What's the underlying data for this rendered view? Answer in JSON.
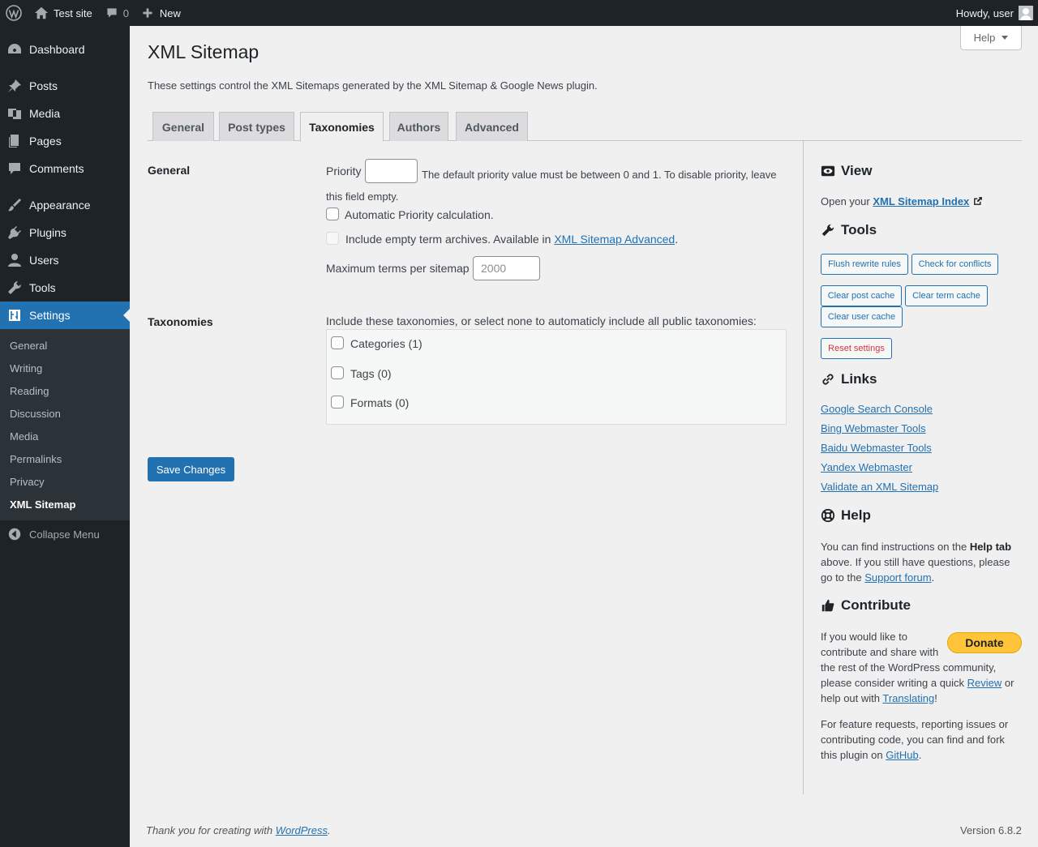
{
  "adminbar": {
    "site_name": "Test site",
    "comments_count": "0",
    "new_label": "New",
    "howdy": "Howdy, user"
  },
  "sidebar": {
    "items": [
      {
        "label": "Dashboard",
        "icon": "dashboard-icon"
      },
      {
        "label": "Posts",
        "icon": "pin-icon"
      },
      {
        "label": "Media",
        "icon": "media-icon"
      },
      {
        "label": "Pages",
        "icon": "pages-icon"
      },
      {
        "label": "Comments",
        "icon": "comment-icon"
      },
      {
        "label": "Appearance",
        "icon": "brush-icon"
      },
      {
        "label": "Plugins",
        "icon": "plug-icon"
      },
      {
        "label": "Users",
        "icon": "user-icon"
      },
      {
        "label": "Tools",
        "icon": "wrench-icon"
      },
      {
        "label": "Settings",
        "icon": "settings-icon"
      }
    ],
    "submenu": [
      "General",
      "Writing",
      "Reading",
      "Discussion",
      "Media",
      "Permalinks",
      "Privacy",
      "XML Sitemap"
    ],
    "collapse": "Collapse Menu"
  },
  "help_button": "Help",
  "page": {
    "title": "XML Sitemap",
    "intro": "These settings control the XML Sitemaps generated by the XML Sitemap & Google News plugin.",
    "tabs": [
      "General",
      "Post types",
      "Taxonomies",
      "Authors",
      "Advanced"
    ],
    "active_tab": "Taxonomies"
  },
  "general_section": {
    "label": "General",
    "priority_label": "Priority",
    "priority_value": "",
    "priority_desc_1": "The default priority value must be between 0 and 1. To disable priority, leave",
    "priority_desc_2": "this field empty.",
    "auto_priority": "Automatic Priority calculation.",
    "empty_terms_text": "Include empty term archives. Available in ",
    "empty_terms_link": "XML Sitemap Advanced",
    "empty_terms_end": ".",
    "max_terms_label": "Maximum terms per sitemap",
    "max_terms_placeholder": "2000"
  },
  "taxonomies_section": {
    "label": "Taxonomies",
    "intro": "Include these taxonomies, or select none to automaticly include all public taxonomies:",
    "items": [
      "Categories (1)",
      "Tags (0)",
      "Formats (0)"
    ]
  },
  "save_button": "Save Changes",
  "right_panel": {
    "view_heading": "View",
    "view_text": "Open your ",
    "view_link": "XML Sitemap Index",
    "tools_heading": "Tools",
    "tool_buttons": [
      "Flush rewrite rules",
      "Check for conflicts",
      "Clear post cache",
      "Clear term cache",
      "Clear user cache"
    ],
    "reset_button": "Reset settings",
    "links_heading": "Links",
    "links": [
      "Google Search Console",
      "Bing Webmaster Tools",
      "Baidu Webmaster Tools",
      "Yandex Webmaster",
      "Validate an XML Sitemap"
    ],
    "help_heading": "Help",
    "help_line1_a": "You can find instructions on the ",
    "help_line1_b": "Help tab",
    "help_line2": "above. If you still have questions, please",
    "help_line3_a": "go to the ",
    "help_line3_link": "Support forum",
    "help_line3_end": ".",
    "contribute_heading": "Contribute",
    "donate_label": "Donate",
    "contribute_lines": [
      "If you would like to",
      "contribute and share with",
      "the rest of the WordPress community,"
    ],
    "contribute_line4_a": "please consider writing a quick ",
    "contribute_line4_link": "Review",
    "contribute_line4_end": " or",
    "contribute_line5_a": "help out with ",
    "contribute_line5_link": "Translating",
    "contribute_line5_end": "!",
    "feature_lines": [
      "For feature requests, reporting issues or",
      "contributing code, you can find and fork"
    ],
    "feature_line3_a": "this plugin on ",
    "feature_line3_link": "GitHub",
    "feature_line3_end": "."
  },
  "footer": {
    "thanks": "Thank you for creating with ",
    "wp_link": "WordPress",
    "thanks_end": ".",
    "version": "Version 6.8.2"
  }
}
